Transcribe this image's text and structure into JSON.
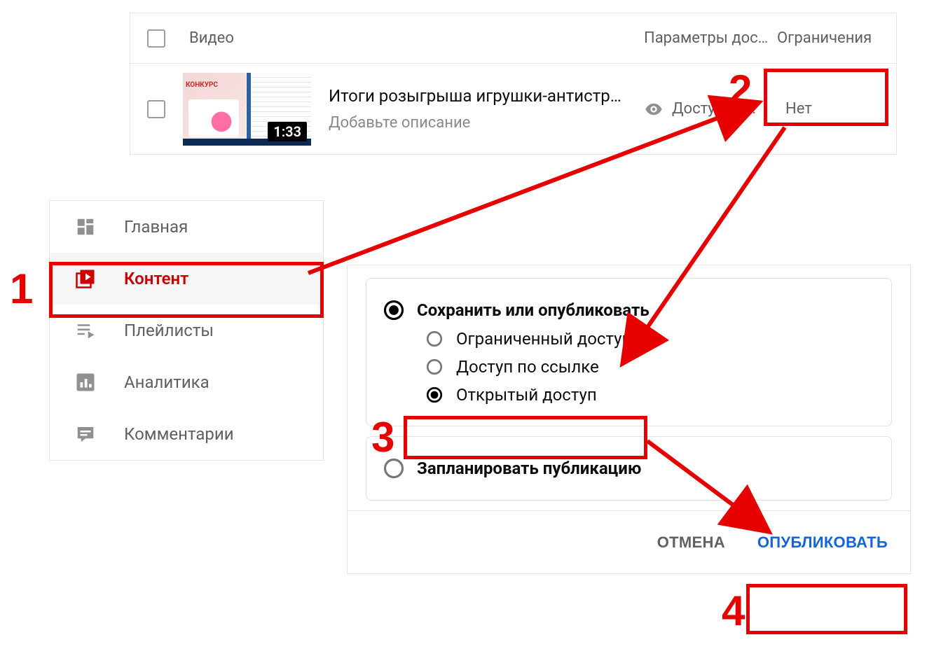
{
  "list": {
    "header": {
      "video_col": "Видео",
      "access_col": "Параметры дос…",
      "restrictions_col": "Ограничения"
    },
    "row": {
      "title": "Итоги розыгрыша игрушки-антистр…",
      "description": "Добавьте описание",
      "duration": "1:33",
      "access": "Доступ по…",
      "restriction": "Нет"
    }
  },
  "sidebar": {
    "items": [
      {
        "label": "Главная"
      },
      {
        "label": "Контент"
      },
      {
        "label": "Плейлисты"
      },
      {
        "label": "Аналитика"
      },
      {
        "label": "Комментарии"
      }
    ]
  },
  "panel": {
    "save_or_publish": "Сохранить или опубликовать",
    "options": {
      "private": "Ограниченный доступ",
      "unlisted": "Доступ по ссылке",
      "public": "Открытый доступ"
    },
    "schedule": "Запланировать публикацию",
    "cancel": "ОТМЕНА",
    "publish": "ОПУБЛИКОВАТЬ"
  },
  "annotation": {
    "1": "1",
    "2": "2",
    "3": "3",
    "4": "4"
  }
}
